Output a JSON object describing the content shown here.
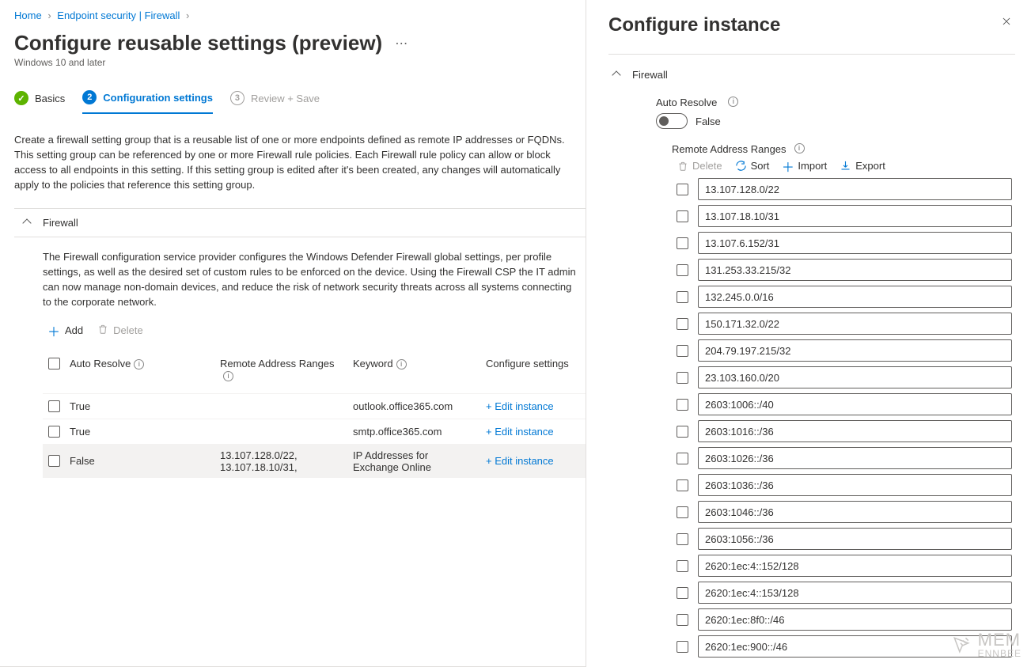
{
  "breadcrumb": {
    "home": "Home",
    "mid": "Endpoint security | Firewall"
  },
  "page": {
    "title": "Configure reusable settings (preview)",
    "subtitle": "Windows 10 and later",
    "more": "⋯"
  },
  "wizard": {
    "t1": "Basics",
    "t2": "Configuration settings",
    "t2num": "2",
    "t3": "Review + Save",
    "t3num": "3"
  },
  "description": "Create a firewall setting group that is a reusable list of one or more endpoints defined as remote IP addresses or FQDNs. This setting group can be referenced by one or more Firewall rule policies. Each Firewall rule policy can allow or block access to all endpoints in this setting. If this setting group is edited after it's been created, any changes will automatically apply to the policies that reference this setting group.",
  "section": {
    "title": "Firewall",
    "subdesc": "The Firewall configuration service provider configures the Windows Defender Firewall global settings, per profile settings, as well as the desired set of custom rules to be enforced on the device. Using the Firewall CSP the IT admin can now manage non-domain devices, and reduce the risk of network security threats across all systems connecting to the corporate network.",
    "add": "Add",
    "delete": "Delete"
  },
  "table": {
    "head": {
      "auto": "Auto Resolve",
      "ranges": "Remote Address Ranges",
      "keyword": "Keyword",
      "cfg": "Configure settings"
    },
    "rows": [
      {
        "auto": "True",
        "ranges": "",
        "keyword": "outlook.office365.com",
        "cfg": "+ Edit instance"
      },
      {
        "auto": "True",
        "ranges": "",
        "keyword": "smtp.office365.com",
        "cfg": "+ Edit instance"
      },
      {
        "auto": "False",
        "ranges": "13.107.128.0/22, 13.107.18.10/31,",
        "keyword": "IP Addresses for Exchange Online",
        "cfg": "+ Edit instance"
      }
    ]
  },
  "panel": {
    "title": "Configure instance",
    "section": "Firewall",
    "autoResolve": {
      "label": "Auto Resolve",
      "value": "False"
    },
    "rarLabel": "Remote Address Ranges",
    "toolbar": {
      "delete": "Delete",
      "sort": "Sort",
      "import": "Import",
      "export": "Export"
    },
    "entries": [
      "13.107.128.0/22",
      "13.107.18.10/31",
      "13.107.6.152/31",
      "131.253.33.215/32",
      "132.245.0.0/16",
      "150.171.32.0/22",
      "204.79.197.215/32",
      "23.103.160.0/20",
      "2603:1006::/40",
      "2603:1016::/36",
      "2603:1026::/36",
      "2603:1036::/36",
      "2603:1046::/36",
      "2603:1056::/36",
      "2620:1ec:4::152/128",
      "2620:1ec:4::153/128",
      "2620:1ec:8f0::/46",
      "2620:1ec:900::/46"
    ]
  },
  "watermark": {
    "line1": "MEM",
    "line2": "ENNBEE"
  }
}
